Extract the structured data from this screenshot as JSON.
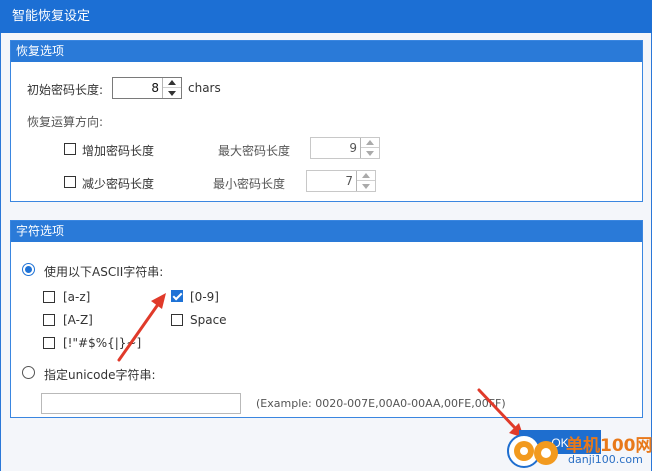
{
  "window": {
    "title": "智能恢复设定"
  },
  "recovery_options": {
    "header": "恢复选项",
    "initial_length_label": "初始密码长度:",
    "initial_length_value": "8",
    "initial_length_unit": "chars",
    "direction_label": "恢复运算方向:",
    "increase_label": "增加密码长度",
    "decrease_label": "减少密码长度",
    "max_length_label": "最大密码长度",
    "max_length_value": "9",
    "min_length_label": "最小密码长度",
    "min_length_value": "7"
  },
  "charset_options": {
    "header": "字符选项",
    "use_ascii_label": "使用以下ASCII字符串:",
    "lower_label": "[a-z]",
    "digits_label": "[0-9]",
    "upper_label": "[A-Z]",
    "space_label": "Space",
    "symbols_label": "[!\"#$%{|}~]",
    "unicode_label": "指定unicode字符串:",
    "unicode_value": "",
    "example_text": "(Example: 0020-007E,00A0-00AA,00FE,00FF)"
  },
  "footer": {
    "ok_label": "OK"
  },
  "watermark": {
    "brand": "单机100网",
    "domain": "danji100.com"
  },
  "colors": {
    "accent": "#1e72d6",
    "annotation": "#e03a2a"
  }
}
